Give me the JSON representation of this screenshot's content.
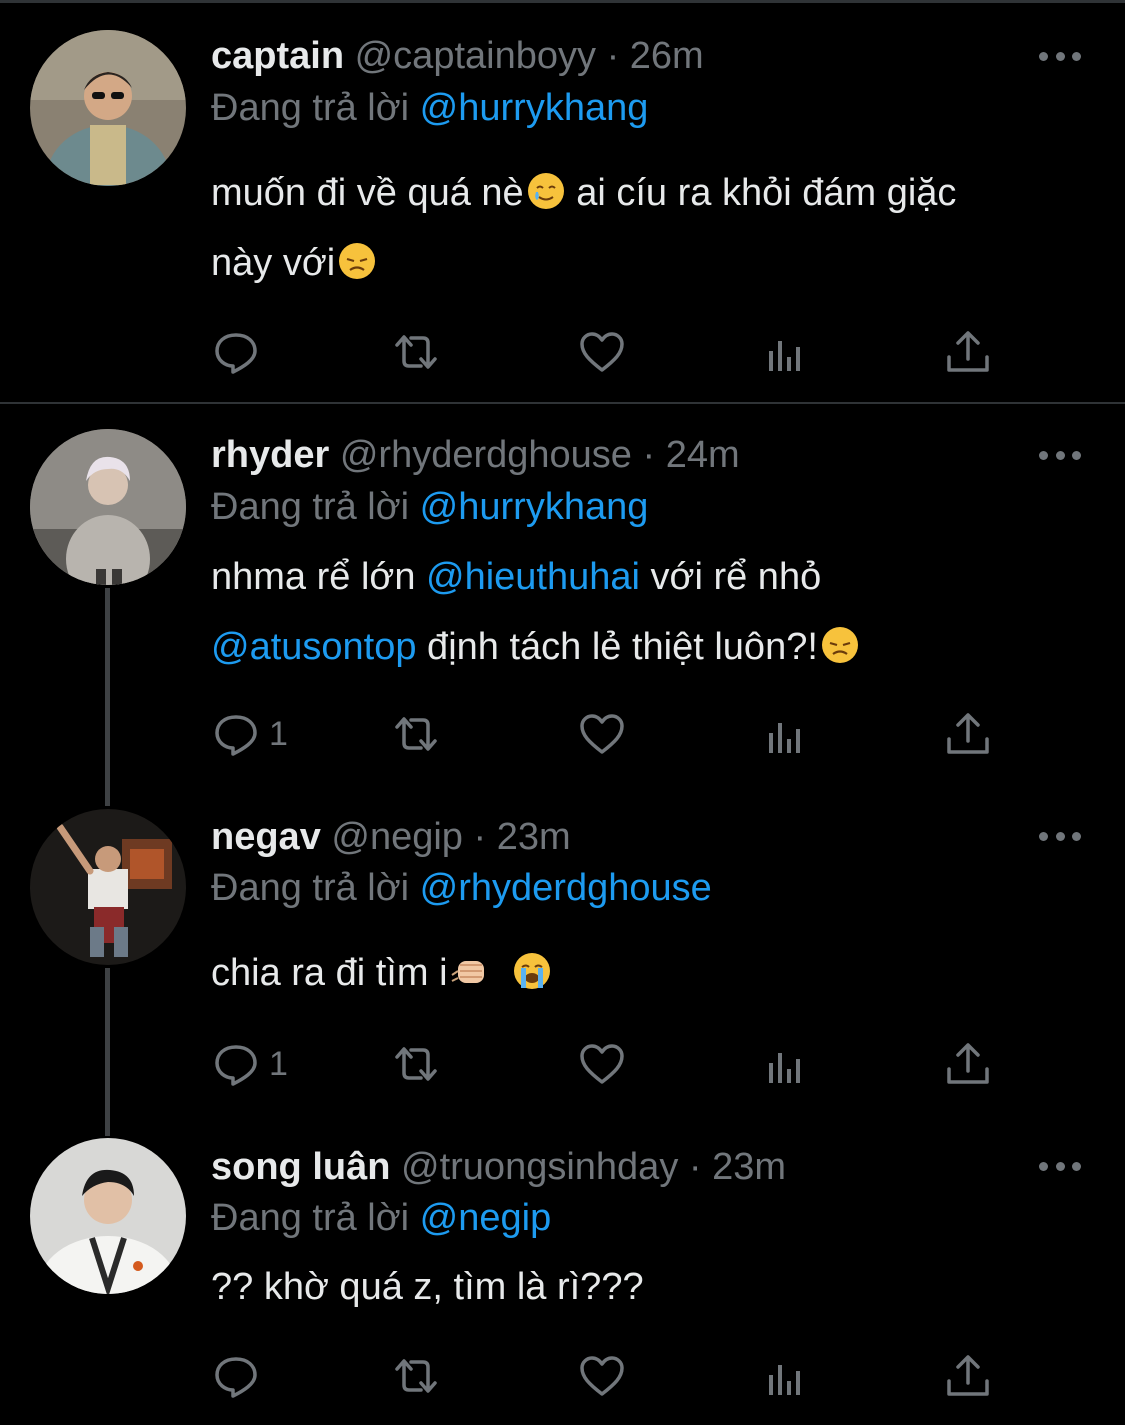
{
  "tweets": [
    {
      "name": "captain",
      "handle": "@captainboyy",
      "time": "26m",
      "replying_label": "Đang trả lời",
      "replying_to": "@hurrykhang",
      "text_line1": "muốn đi về quá nè",
      "text_line1b": "  ai cíu ra khỏi đám giặc",
      "text_line2": "này với",
      "reply_count": ""
    },
    {
      "name": "rhyder",
      "handle": "@rhyderdghouse",
      "time": "24m",
      "replying_label": "Đang trả lời",
      "replying_to": "@hurrykhang",
      "text_line1a": "nhma rể lớn ",
      "text_line1_mention": "@hieuthuhai",
      "text_line1b": " với rể nhỏ",
      "text_line2_mention": "@atusontop",
      "text_line2b": " định tách lẻ thiệt luôn?!",
      "reply_count": "1"
    },
    {
      "name": "negav",
      "handle": "@negip",
      "time": "23m",
      "replying_label": "Đang trả lời",
      "replying_to": "@rhyderdghouse",
      "text_line1": "chia ra đi tìm i",
      "reply_count": "1"
    },
    {
      "name": "song luân",
      "handle": "@truongsinhday",
      "time": "23m",
      "replying_label": "Đang trả lời",
      "replying_to": "@negip",
      "text_line1": "?? khờ quá z, tìm là rì???",
      "reply_count": ""
    }
  ],
  "colors": {
    "background": "#000000",
    "text": "#e7e9ea",
    "muted": "#71767b",
    "mention": "#1d9bf0",
    "divider": "#2f3336"
  },
  "icons": [
    "reply-icon",
    "retweet-icon",
    "like-icon",
    "analytics-icon",
    "share-icon",
    "more-icon"
  ]
}
